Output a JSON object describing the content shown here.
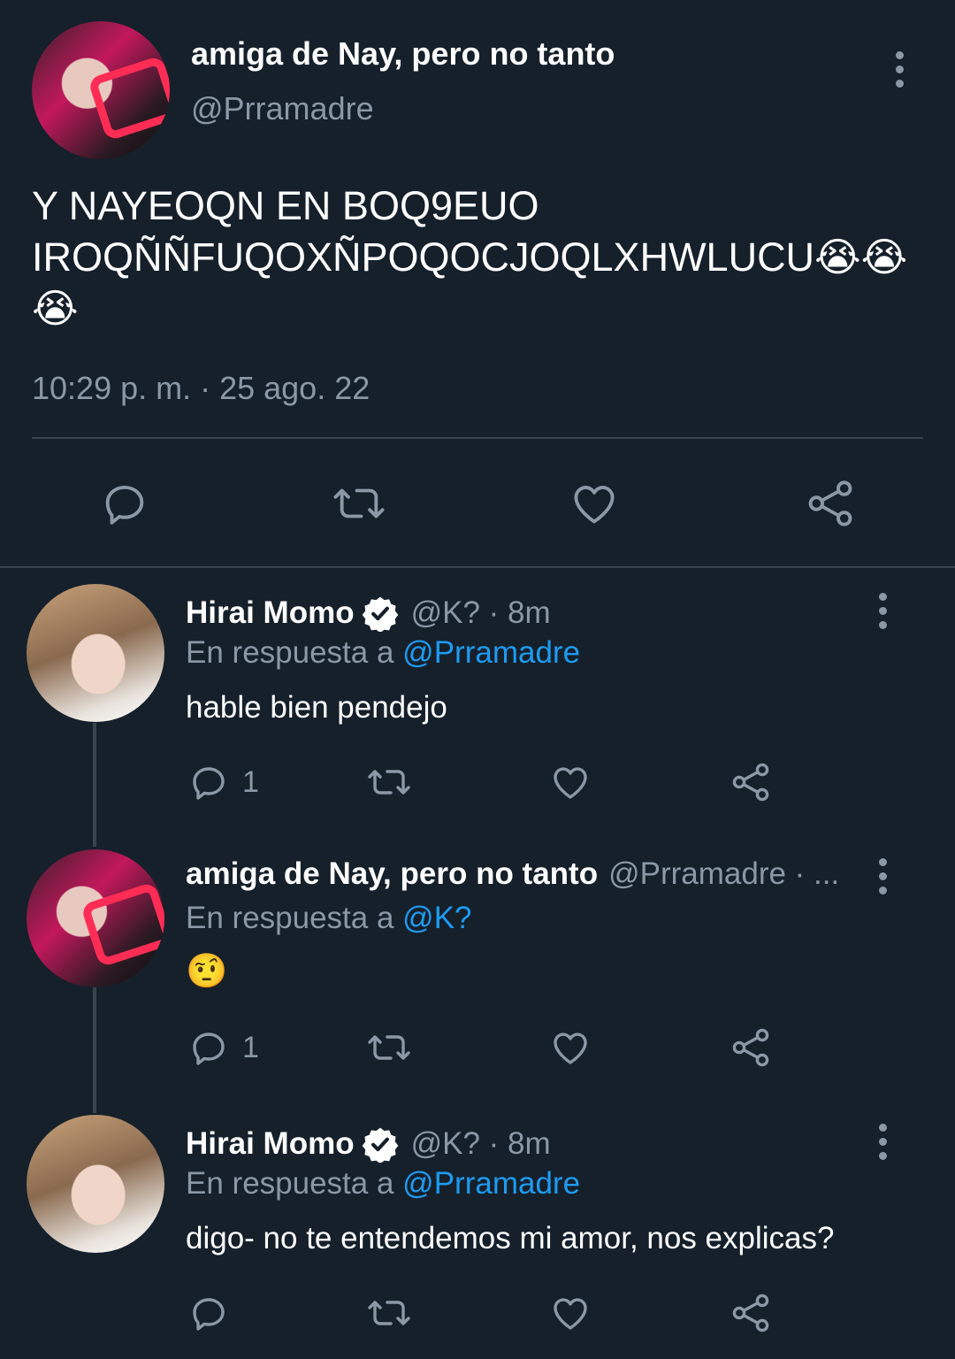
{
  "main_tweet": {
    "display_name": "amiga de Nay, pero no tanto",
    "handle": "@Prramadre",
    "text_line1": "Y NAYEOQN EN BOQ9EUO",
    "text_line2": "IROQÑÑFUQOXÑPOQOCJOQLXHWLUCU😭😭",
    "text_line3": "😭",
    "timestamp": "10:29 p. m. · 25 ago. 22"
  },
  "replies": [
    {
      "display_name": "Hirai Momo",
      "handle_time": "@K? · 8m",
      "reply_prefix": "En respuesta a",
      "reply_to": "@Prramadre",
      "text": "hable bien pendejo",
      "reply_count": "1"
    },
    {
      "display_name": "amiga de Nay, pero no tanto",
      "handle_time": "@Prramadre · ...",
      "reply_prefix": "En respuesta a",
      "reply_to": "@K?",
      "text": "🤨",
      "reply_count": "1"
    },
    {
      "display_name": "Hirai Momo",
      "handle_time": "@K? · 8m",
      "reply_prefix": "En respuesta a",
      "reply_to": "@Prramadre",
      "text": "digo- no te entendemos mi amor, nos explicas?",
      "reply_count": ""
    }
  ],
  "colors": {
    "background": "#15202b",
    "muted": "#8b98a5",
    "link": "#1d9bf0",
    "divider": "#38444d"
  },
  "icons": [
    "kebab-menu-icon",
    "reply-icon",
    "retweet-icon",
    "like-icon",
    "share-icon",
    "verified-badge-icon"
  ]
}
